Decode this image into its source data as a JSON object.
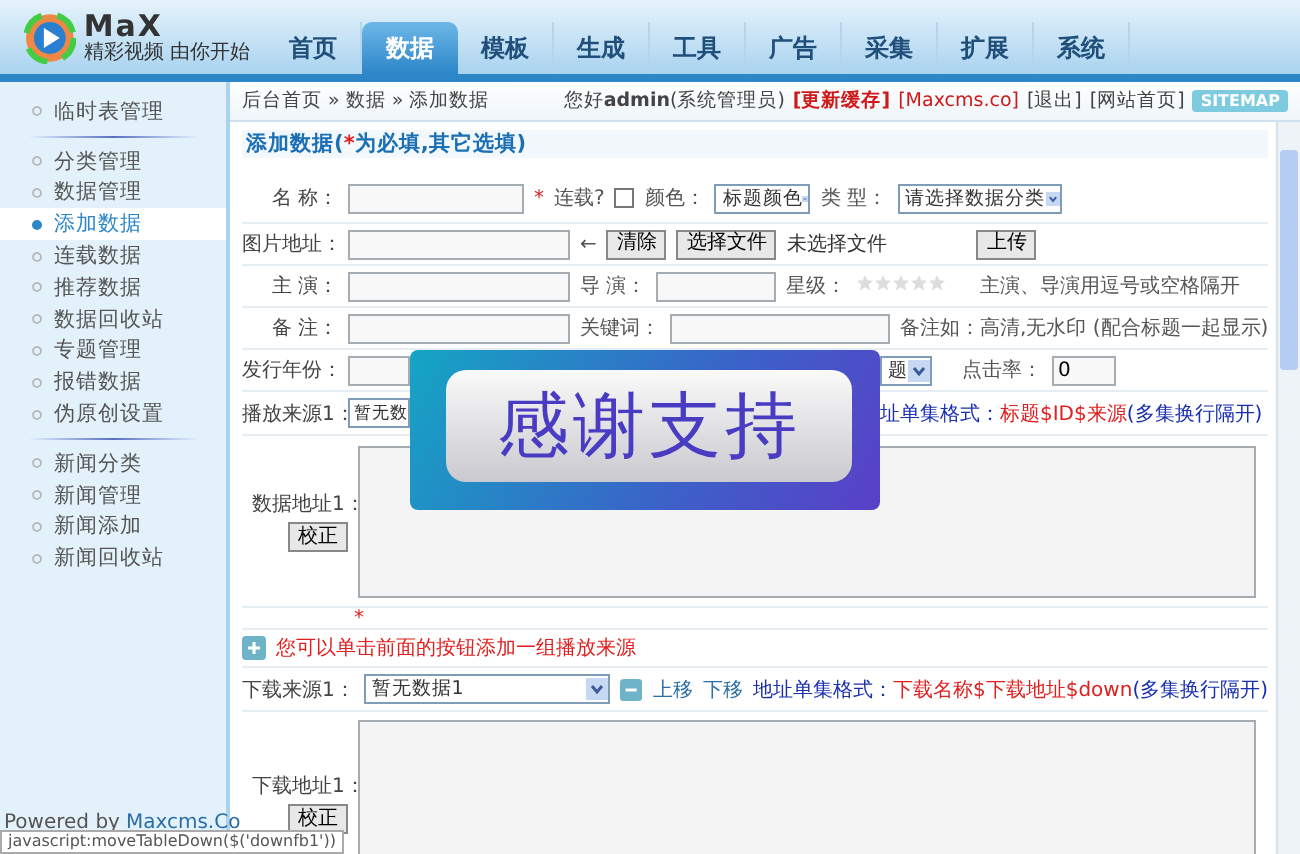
{
  "logo": {
    "name": "MaX",
    "slogan": "精彩视频 由你开始"
  },
  "nav": [
    {
      "label": "首页",
      "selected": false
    },
    {
      "label": "数据",
      "selected": true
    },
    {
      "label": "模板",
      "selected": false
    },
    {
      "label": "生成",
      "selected": false
    },
    {
      "label": "工具",
      "selected": false
    },
    {
      "label": "广告",
      "selected": false
    },
    {
      "label": "采集",
      "selected": false
    },
    {
      "label": "扩展",
      "selected": false
    },
    {
      "label": "系统",
      "selected": false
    }
  ],
  "breadcrumb": "后台首页 » 数据 » 添加数据",
  "user_bar": {
    "greeting": "您好",
    "user": "admin",
    "role": "(系统管理员)",
    "links": [
      {
        "label": "[更新缓存]",
        "kind": "strong"
      },
      {
        "label": "[Maxcms.co]",
        "kind": "red"
      },
      {
        "label": "[退出]",
        "kind": "plain"
      },
      {
        "label": "[网站首页]",
        "kind": "plain"
      }
    ],
    "sitemap": "SITEMAP"
  },
  "sidebar": {
    "groups": [
      [
        {
          "label": "临时表管理",
          "selected": false
        }
      ],
      [
        {
          "label": "分类管理",
          "selected": false
        },
        {
          "label": "数据管理",
          "selected": false
        },
        {
          "label": "添加数据",
          "selected": true
        },
        {
          "label": "连载数据",
          "selected": false
        },
        {
          "label": "推荐数据",
          "selected": false
        },
        {
          "label": "数据回收站",
          "selected": false
        },
        {
          "label": "专题管理",
          "selected": false
        },
        {
          "label": "报错数据",
          "selected": false
        },
        {
          "label": "伪原创设置",
          "selected": false
        }
      ],
      [
        {
          "label": "新闻分类",
          "selected": false
        },
        {
          "label": "新闻管理",
          "selected": false
        },
        {
          "label": "新闻添加",
          "selected": false
        },
        {
          "label": "新闻回收站",
          "selected": false
        }
      ]
    ]
  },
  "form": {
    "title": "添加数据(",
    "title_mark": "*",
    "title_rest": "为必填,其它选填)",
    "name_row": {
      "label": "名 称：",
      "required": "*",
      "serial_label": "连载?",
      "serial_checked": false,
      "color_label": "颜色：",
      "color_select": "标题颜色",
      "type_label": "类 型：",
      "type_select": "请选择数据分类"
    },
    "pic_row": {
      "label": "图片地址：",
      "arrow": "←",
      "clear_button": "清除",
      "file_button": "选择文件",
      "file_status": "未选择文件",
      "upload_button": "上传"
    },
    "actor_row": {
      "label": "主 演：",
      "director_label": "导 演：",
      "stars_label": "星级：",
      "stars": 0,
      "hint": "主演、导演用逗号或空格隔开"
    },
    "note_row": {
      "label": "备 注：",
      "keywords_label": "关键词：",
      "hint": "备注如：高清,无水印 (配合标题一起显示)"
    },
    "year_row": {
      "label": "发行年份：",
      "color_select": "题",
      "hits_label": "点击率：",
      "hits_value": "0"
    },
    "play_source": {
      "label": "播放来源1：",
      "select": "暂无数",
      "format_label": "址单集格式：",
      "format_value": "标题$ID$来源",
      "format_note": "(多集换行隔开)"
    },
    "play_urls": {
      "label": "数据地址1：",
      "button": "校正",
      "required": "*"
    },
    "add_hint": "您可以单击前面的按钮添加一组播放来源",
    "down_source": {
      "label": "下载来源1：",
      "select": "暂无数据1",
      "up": "上移",
      "down": "下移",
      "format_label": "地址单集格式：",
      "format_value": "下载名称$下载地址$down",
      "format_note": "(多集换行隔开)"
    },
    "down_urls": {
      "label": "下载地址1：",
      "button": "校正"
    }
  },
  "overlay": {
    "text": "感谢支持"
  },
  "footer": {
    "text": "Powered by",
    "link": "Maxcms.Co"
  },
  "status_bar": "javascript:moveTableDown($('downfb1'))"
}
